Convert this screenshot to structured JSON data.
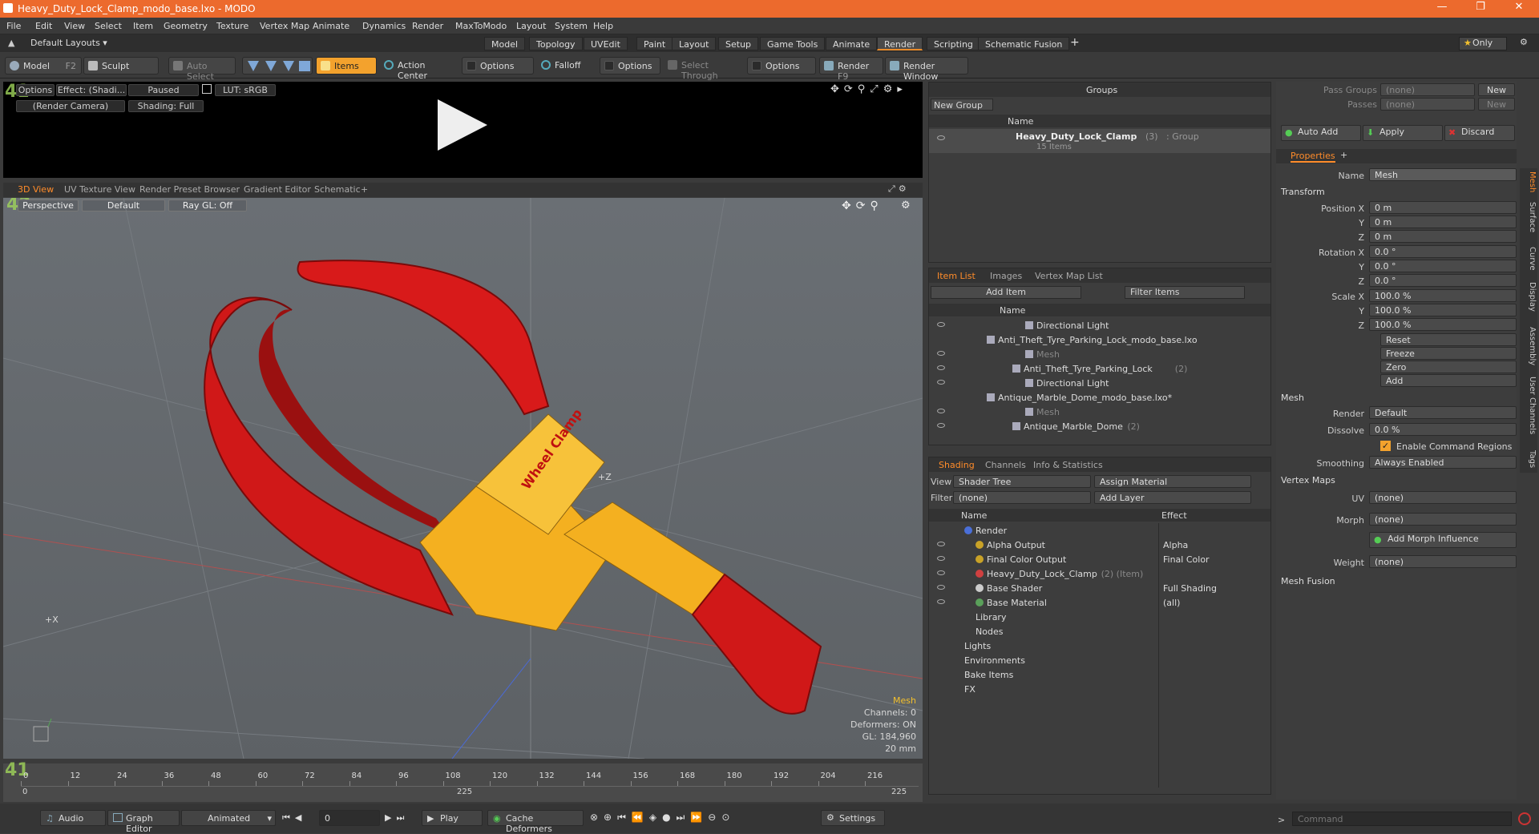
{
  "window": {
    "title": "Heavy_Duty_Lock_Clamp_modo_base.lxo - MODO"
  },
  "menu": [
    "File",
    "Edit",
    "View",
    "Select",
    "Item",
    "Geometry",
    "Texture",
    "Vertex Map",
    "Animate",
    "Dynamics",
    "Render",
    "MaxToModo",
    "Layout",
    "System",
    "Help"
  ],
  "layouts": {
    "preset": "Default Layouts ▾",
    "tabs": [
      "Model",
      "Topology",
      "UVEdit",
      "Paint",
      "Layout",
      "Setup",
      "Game Tools",
      "Animate",
      "Render",
      "Scripting",
      "Schematic Fusion"
    ],
    "active": "Render",
    "only": "Only"
  },
  "toolbar": {
    "model": "Model",
    "model_key": "F2",
    "sculpt": "Sculpt",
    "auto_select": "Auto Select",
    "items": "Items",
    "action_center": "Action Center",
    "options1": "Options",
    "falloff": "Falloff",
    "options2": "Options",
    "select_through": "Select Through",
    "options3": "Options",
    "render": "Render",
    "render_key": "F9",
    "render_window": "Render Window"
  },
  "preview": {
    "options": "Options",
    "effect": "Effect: (Shadi...",
    "paused": "Paused",
    "lut": "LUT: sRGB",
    "camera": "(Render Camera)",
    "shading": "Shading: Full"
  },
  "viewport_tabs": [
    "3D View",
    "UV Texture View",
    "Render Preset Browser",
    "Gradient Editor",
    "Schematic"
  ],
  "viewport": {
    "perspective": "Perspective",
    "default": "Default",
    "raygl": "Ray GL: Off",
    "label": "Wheel Clamp",
    "axis_z": "+Z",
    "axis_x": "+X",
    "stats": {
      "title": "Mesh",
      "channels": "Channels: 0",
      "deformers": "Deformers: ON",
      "gl": "GL: 184,960",
      "size": "20 mm"
    }
  },
  "timeline": {
    "ticks": [
      "0",
      "12",
      "24",
      "36",
      "48",
      "60",
      "72",
      "84",
      "96",
      "108",
      "120",
      "132",
      "144",
      "156",
      "168",
      "180",
      "192",
      "204",
      "216"
    ],
    "start": "0",
    "mid": "225",
    "end": "225"
  },
  "bottom": {
    "audio": "Audio",
    "graph": "Graph Editor",
    "animated": "Animated",
    "frame": "0",
    "play": "Play",
    "cache": "Cache Deformers",
    "settings": "Settings",
    "command_placeholder": "Command"
  },
  "groups": {
    "title": "Groups",
    "new_group": "New Group",
    "col_name": "Name",
    "item_name": "Heavy_Duty_Lock_Clamp",
    "item_count": "(3)",
    "item_type": ": Group",
    "item_sub": "15 Items"
  },
  "item_list": {
    "tabs": [
      "Item List",
      "Images",
      "Vertex Map List"
    ],
    "add_item": "Add Item",
    "filter": "Filter Items",
    "col_name": "Name",
    "rows": [
      {
        "label": "Directional Light",
        "indent": 4,
        "dim": false,
        "suffix": ""
      },
      {
        "label": "Anti_Theft_Tyre_Parking_Lock_modo_base.lxo",
        "indent": 1,
        "dim": false,
        "suffix": ""
      },
      {
        "label": "Mesh",
        "indent": 4,
        "dim": true,
        "suffix": ""
      },
      {
        "label": "Anti_Theft_Tyre_Parking_Lock",
        "indent": 3,
        "dim": false,
        "suffix": "(2)"
      },
      {
        "label": "Directional Light",
        "indent": 4,
        "dim": false,
        "suffix": ""
      },
      {
        "label": "Antique_Marble_Dome_modo_base.lxo*",
        "indent": 1,
        "dim": false,
        "suffix": ""
      },
      {
        "label": "Mesh",
        "indent": 4,
        "dim": true,
        "suffix": ""
      },
      {
        "label": "Antique_Marble_Dome",
        "indent": 3,
        "dim": false,
        "suffix": "(2)"
      }
    ]
  },
  "shading": {
    "tabs": [
      "Shading",
      "Channels",
      "Info & Statistics"
    ],
    "view_label": "View",
    "view": "Shader Tree",
    "assign": "Assign Material",
    "filter_label": "Filter",
    "filter": "(none)",
    "add_layer": "Add Layer",
    "col_name": "Name",
    "col_effect": "Effect",
    "rows": [
      {
        "label": "Render",
        "effect": "",
        "indent": 2,
        "suffix": "",
        "color": "#4a6fd8"
      },
      {
        "label": "Alpha Output",
        "effect": "Alpha",
        "indent": 3,
        "suffix": "",
        "color": "#c9a227"
      },
      {
        "label": "Final Color Output",
        "effect": "Final Color",
        "indent": 3,
        "suffix": "",
        "color": "#c9a227"
      },
      {
        "label": "Heavy_Duty_Lock_Clamp",
        "effect": "",
        "indent": 3,
        "suffix": "(2) (Item)",
        "color": "#d04040"
      },
      {
        "label": "Base Shader",
        "effect": "Full Shading",
        "indent": 3,
        "suffix": "",
        "color": "#cccccc"
      },
      {
        "label": "Base Material",
        "effect": "(all)",
        "indent": 3,
        "suffix": "",
        "color": "#5aa05a"
      },
      {
        "label": "Library",
        "effect": "",
        "indent": 2,
        "suffix": "",
        "color": ""
      },
      {
        "label": "Nodes",
        "effect": "",
        "indent": 2,
        "suffix": "",
        "color": ""
      },
      {
        "label": "Lights",
        "effect": "",
        "indent": 1,
        "suffix": "",
        "color": ""
      },
      {
        "label": "Environments",
        "effect": "",
        "indent": 1,
        "suffix": "",
        "color": ""
      },
      {
        "label": "Bake Items",
        "effect": "",
        "indent": 1,
        "suffix": "",
        "color": ""
      },
      {
        "label": "FX",
        "effect": "",
        "indent": 1,
        "suffix": "",
        "color": ""
      }
    ]
  },
  "pass": {
    "groups_label": "Pass Groups",
    "groups_value": "(none)",
    "passes_label": "Passes",
    "passes_value": "(none)",
    "new": "New",
    "auto_add": "Auto Add",
    "apply": "Apply",
    "discard": "Discard"
  },
  "properties": {
    "tab": "Properties",
    "name_label": "Name",
    "name": "Mesh",
    "transform": "Transform",
    "position": [
      "0 m",
      "0 m",
      "0 m"
    ],
    "rotation": [
      "0.0 °",
      "0.0 °",
      "0.0 °"
    ],
    "scale": [
      "100.0 %",
      "100.0 %",
      "100.0 %"
    ],
    "pos_label": "Position X",
    "rot_label": "Rotation X",
    "scale_label": "Scale X",
    "y": "Y",
    "z": "Z",
    "reset": "Reset",
    "freeze": "Freeze",
    "zero": "Zero",
    "add": "Add",
    "mesh": "Mesh",
    "render_label": "Render",
    "render": "Default",
    "dissolve_label": "Dissolve",
    "dissolve": "0.0 %",
    "enable_cmd": "Enable Command Regions",
    "smoothing_label": "Smoothing",
    "smoothing": "Always Enabled",
    "vertex_maps": "Vertex Maps",
    "uv_label": "UV",
    "uv": "(none)",
    "morph_label": "Morph",
    "morph": "(none)",
    "add_morph": "Add Morph Influence",
    "weight_label": "Weight",
    "weight": "(none)",
    "mesh_fusion": "Mesh Fusion",
    "side_tabs": [
      "Mesh",
      "Surface",
      "Curve",
      "Display",
      "Assembly",
      "User Channels",
      "Tags"
    ]
  }
}
